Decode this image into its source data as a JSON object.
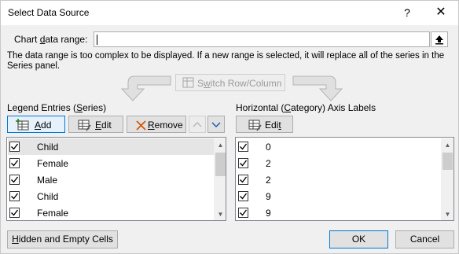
{
  "window": {
    "title": "Select Data Source",
    "help_glyph": "?",
    "close_glyph": "✕"
  },
  "range": {
    "label_pre": "Chart ",
    "label_accel": "d",
    "label_post": "ata range:",
    "value": ""
  },
  "info_text": "The data range is too complex to be displayed. If a new range is selected, it will replace all of the series in the Series panel.",
  "switch_button": {
    "pre": "S",
    "accel": "w",
    "post": "itch Row/Column"
  },
  "legend": {
    "header_pre": "Legend Entries (",
    "header_accel": "S",
    "header_post": "eries)",
    "add": {
      "accel": "A",
      "post": "dd"
    },
    "edit": {
      "accel": "E",
      "post": "dit"
    },
    "remove": {
      "accel": "R",
      "post": "emove"
    },
    "items": [
      {
        "label": "Child",
        "checked": true,
        "selected": true
      },
      {
        "label": "Female",
        "checked": true,
        "selected": false
      },
      {
        "label": "Male",
        "checked": true,
        "selected": false
      },
      {
        "label": "Child",
        "checked": true,
        "selected": false
      },
      {
        "label": "Female",
        "checked": true,
        "selected": false
      }
    ]
  },
  "axis": {
    "header_pre": "Horizontal (",
    "header_accel": "C",
    "header_post": "ategory) Axis Labels",
    "edit": {
      "pre": "Edi",
      "accel": "t",
      "post": ""
    },
    "items": [
      {
        "label": "0",
        "checked": true
      },
      {
        "label": "2",
        "checked": true
      },
      {
        "label": "2",
        "checked": true
      },
      {
        "label": "9",
        "checked": true
      },
      {
        "label": "9",
        "checked": true
      }
    ]
  },
  "footer": {
    "hidden_pre": "",
    "hidden_accel": "H",
    "hidden_post": "idden and Empty Cells",
    "ok": "OK",
    "cancel": "Cancel"
  },
  "colors": {
    "accent": "#0078d7",
    "selected_row": "#e5e5e5"
  },
  "icons": {
    "add": "add-series-icon",
    "edit": "edit-icon",
    "remove": "remove-x-icon",
    "up": "move-up-icon",
    "down": "move-down-icon",
    "collapse": "collapse-dialog-icon",
    "switch": "switch-row-column-icon"
  }
}
